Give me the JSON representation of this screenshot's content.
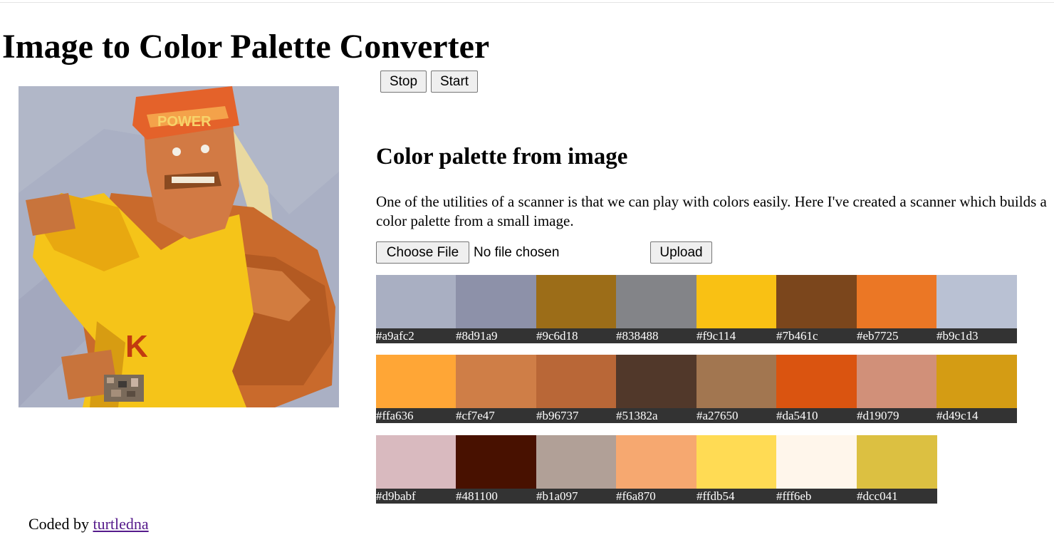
{
  "page": {
    "title": "Image to Color Palette Converter",
    "image_alt": "Uploaded image"
  },
  "controls": {
    "stop_label": "Stop",
    "start_label": "Start"
  },
  "palette_section": {
    "heading": "Color palette from image",
    "description": "One of the utilities of a scanner is that we can play with colors easily. Here I've created a scanner which builds a color palette from a small image.",
    "file_button_label": "Choose File",
    "file_status": "No file chosen",
    "upload_label": "Upload"
  },
  "palette": [
    {
      "hex": "#a9afc2"
    },
    {
      "hex": "#8d91a9"
    },
    {
      "hex": "#9c6d18"
    },
    {
      "hex": "#838488"
    },
    {
      "hex": "#f9c114"
    },
    {
      "hex": "#7b461c"
    },
    {
      "hex": "#eb7725"
    },
    {
      "hex": "#b9c1d3"
    },
    {
      "hex": "#ffa636"
    },
    {
      "hex": "#cf7e47"
    },
    {
      "hex": "#b96737"
    },
    {
      "hex": "#51382a"
    },
    {
      "hex": "#a27650"
    },
    {
      "hex": "#da5410"
    },
    {
      "hex": "#d19079"
    },
    {
      "hex": "#d49c14"
    },
    {
      "hex": "#d9babf"
    },
    {
      "hex": "#481100"
    },
    {
      "hex": "#b1a097"
    },
    {
      "hex": "#f6a870"
    },
    {
      "hex": "#ffdb54"
    },
    {
      "hex": "#fff6eb"
    },
    {
      "hex": "#dcc041"
    }
  ],
  "footer": {
    "prefix": "Coded by",
    "link_text": "turtledna"
  }
}
